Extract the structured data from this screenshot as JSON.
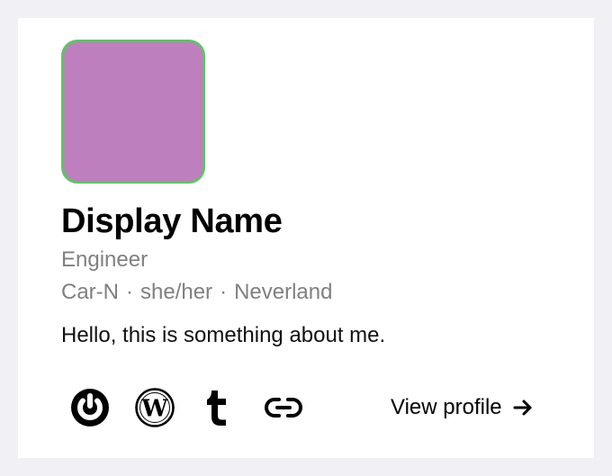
{
  "profile": {
    "display_name": "Display Name",
    "role": "Engineer",
    "meta": {
      "handle": "Car-N",
      "separator": "·",
      "pronouns": "she/her",
      "location": "Neverland"
    },
    "bio": "Hello, this is something about me."
  },
  "social_links": [
    {
      "icon": "power-icon"
    },
    {
      "icon": "wordpress-icon"
    },
    {
      "icon": "tumblr-icon"
    },
    {
      "icon": "link-icon"
    }
  ],
  "view_profile": {
    "label": "View profile",
    "icon": "arrow-right-icon"
  },
  "colors": {
    "background": "#f1f1f5",
    "card": "#ffffff",
    "avatar_fill": "#be7fbe",
    "avatar_border": "#63c06a",
    "muted_text": "#808080",
    "text": "#000000"
  }
}
